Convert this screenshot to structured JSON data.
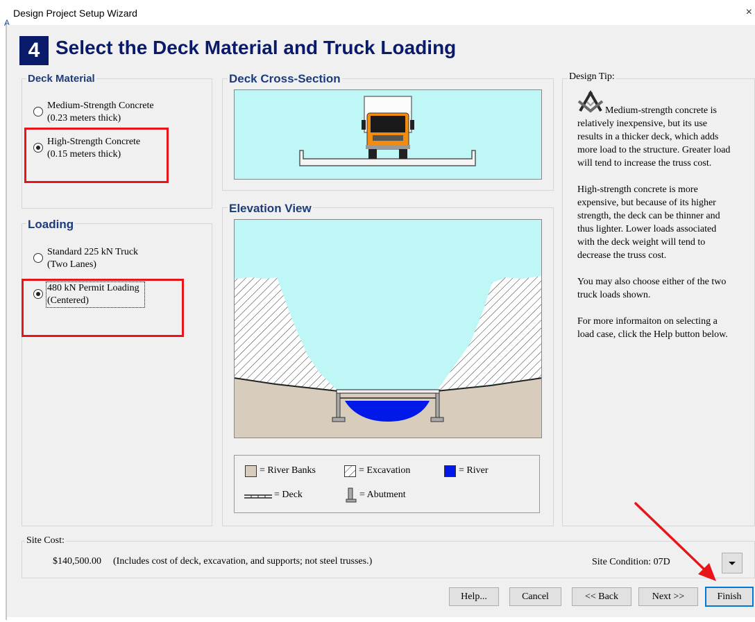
{
  "window": {
    "title": "Design Project Setup Wizard",
    "close": "×",
    "edge_fragment": "A"
  },
  "step": {
    "number": "4",
    "heading": "Select the Deck Material and Truck Loading"
  },
  "deck_material": {
    "title": "Deck Material",
    "options": [
      {
        "line1": "Medium-Strength Concrete",
        "line2": "(0.23 meters thick)",
        "selected": false
      },
      {
        "line1": "High-Strength Concrete",
        "line2": "(0.15 meters thick)",
        "selected": true
      }
    ]
  },
  "loading": {
    "title": "Loading",
    "options": [
      {
        "line1": "Standard 225 kN Truck",
        "line2": "(Two Lanes)",
        "selected": false
      },
      {
        "line1": "480 kN Permit Loading",
        "line2": "(Centered)",
        "selected": true
      }
    ]
  },
  "cross_section": {
    "title": "Deck Cross-Section"
  },
  "elevation": {
    "title": "Elevation View"
  },
  "legend": {
    "river_banks": "= River Banks",
    "excavation": "= Excavation",
    "river": "= River",
    "deck": "= Deck",
    "abutment": "= Abutment"
  },
  "design_tip": {
    "title": "Design Tip:",
    "paragraphs": [
      [
        "Medium-strength concrete is",
        "relatively inexpensive, but its use",
        "results in a thicker deck, which adds",
        "more load to the structure. Greater load",
        "will tend to increase the truss cost."
      ],
      [
        "High-strength concrete is more",
        "expensive, but because of its higher",
        "strength, the deck can be thinner and",
        "thus lighter. Lower loads associated",
        "with the deck weight will tend to",
        "decrease the truss cost."
      ],
      [
        "You may also choose either of the two",
        "truck loads shown."
      ],
      [
        "For more informaiton on selecting a",
        "load case, click the Help button below."
      ]
    ]
  },
  "site": {
    "label": "Site Cost:",
    "cost": "$140,500.00",
    "note": "(Includes cost of deck, excavation, and supports; not steel trusses.)",
    "condition": "Site Condition: 07D"
  },
  "buttons": {
    "help": "Help...",
    "cancel": "Cancel",
    "back": "<< Back",
    "next": "Next >>",
    "finish": "Finish"
  },
  "colors": {
    "heading": "#0a1a6a",
    "group_title": "#1c3c7c",
    "sky": "#bff7f7",
    "bank": "#d8ccbc",
    "river": "#0018e8",
    "annotation_red": "#e8141a"
  },
  "icons": {
    "design_tip": "compass-square-icon",
    "dropdown": "chevron-down-icon"
  }
}
